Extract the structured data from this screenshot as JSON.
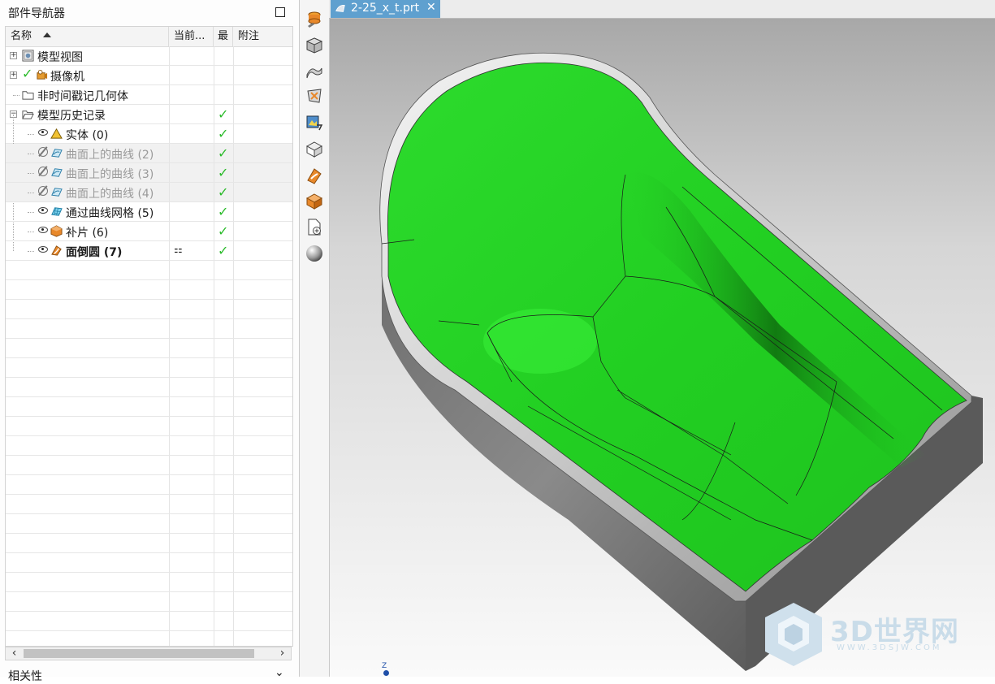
{
  "navigator": {
    "title": "部件导航器",
    "columns": [
      "名称",
      "当前...",
      "最",
      "附注"
    ],
    "rows": [
      {
        "label": "模型视图",
        "icon": "model-view-icon",
        "current": "",
        "latest": ""
      },
      {
        "label": "摄像机",
        "icon": "camera-icon",
        "current": "",
        "latest": ""
      },
      {
        "label": "非时间戳记几何体",
        "icon": "folder-icon",
        "current": "",
        "latest": ""
      },
      {
        "label": "模型历史记录",
        "icon": "folder-open-icon",
        "current": "",
        "latest": "✓"
      },
      {
        "label": "实体 (0)",
        "icon": "solid-body-icon",
        "current": "",
        "latest": "✓"
      },
      {
        "label": "曲面上的曲线 (2)",
        "icon": "curve-on-surface-icon",
        "current": "",
        "latest": "✓"
      },
      {
        "label": "曲面上的曲线 (3)",
        "icon": "curve-on-surface-icon",
        "current": "",
        "latest": "✓"
      },
      {
        "label": "曲面上的曲线 (4)",
        "icon": "curve-on-surface-icon",
        "current": "",
        "latest": "✓"
      },
      {
        "label": "通过曲线网格 (5)",
        "icon": "through-curve-mesh-icon",
        "current": "",
        "latest": "✓"
      },
      {
        "label": "补片 (6)",
        "icon": "patch-icon",
        "current": "",
        "latest": "✓"
      },
      {
        "label": "面倒圆 (7)",
        "icon": "face-blend-icon",
        "current": "⚏",
        "latest": "✓"
      }
    ],
    "related_section": "相关性"
  },
  "tab": {
    "label": "2-25_x_t.prt",
    "close": "✕"
  },
  "watermark": {
    "text": "3D世界网",
    "url": "WWW.3DSJW.COM"
  },
  "colors": {
    "face_green": "#22d322",
    "tab_blue": "#5fa0cf",
    "check_green": "#2bbb2b"
  },
  "axis_label": "Z"
}
